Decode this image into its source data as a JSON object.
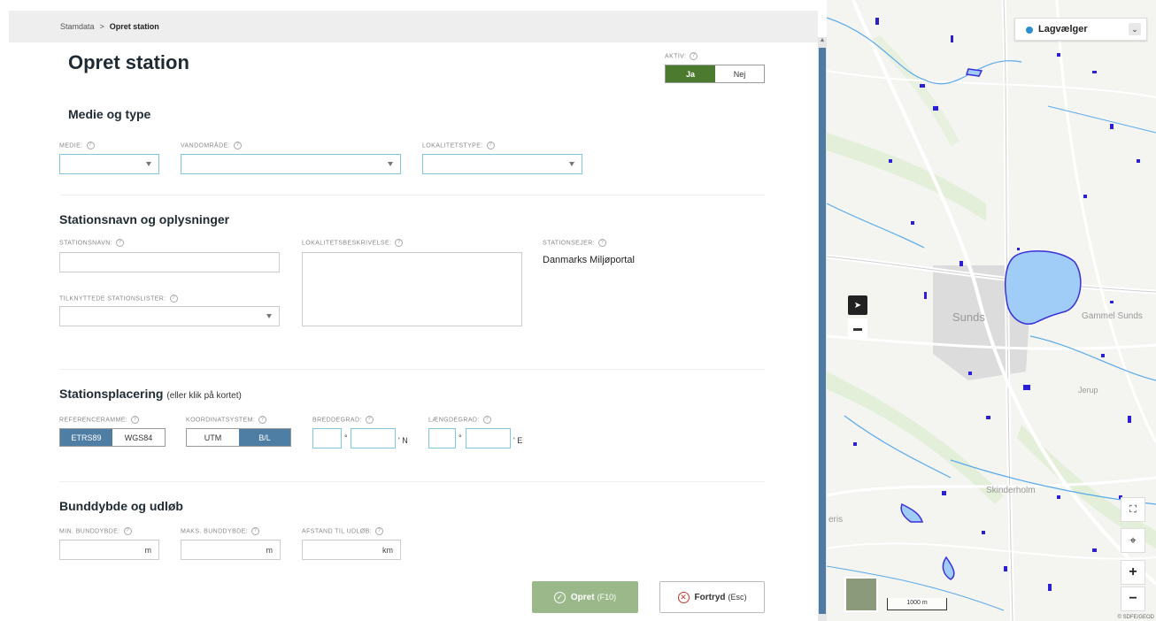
{
  "breadcrumb": {
    "root": "Stamdata",
    "separator": ">",
    "current": "Opret station"
  },
  "page_title": "Opret station",
  "aktiv": {
    "label": "AKTIV:",
    "yes": "Ja",
    "no": "Nej",
    "selected": "Ja"
  },
  "help_glyph": "?",
  "section_medie": {
    "title": "Medie og type",
    "medie_label": "MEDIE:",
    "vandomraade_label": "VANDOMRÅDE:",
    "lokalitetstype_label": "LOKALITETSTYPE:"
  },
  "section_station": {
    "title": "Stationsnavn og oplysninger",
    "stationsnavn_label": "STATIONSNAVN:",
    "lokalitetsbeskrivelse_label": "LOKALITETSBESKRIVELSE:",
    "stationsejer_label": "STATIONSEJER:",
    "stationsejer_value": "Danmarks Miljøportal",
    "tilknyttede_label": "TILKNYTTEDE STATIONSLISTER:"
  },
  "section_placering": {
    "title": "Stationsplacering",
    "subtitle": "(eller klik på kortet)",
    "referenceramme_label": "REFERENCERAMME:",
    "referenceramme_options": [
      "ETRS89",
      "WGS84"
    ],
    "referenceramme_selected": "ETRS89",
    "koordinatsystem_label": "KOORDINATSYSTEM:",
    "koordinatsystem_options": [
      "UTM",
      "B/L"
    ],
    "koordinatsystem_selected": "B/L",
    "breddegrad_label": "BREDDEGRAD:",
    "laengdegrad_label": "LÆNGDEGRAD:",
    "degree_symbol": "°",
    "north_suffix": "' N",
    "east_suffix": "' E"
  },
  "section_bund": {
    "title": "Bunddybde og udløb",
    "min_label": "MIN. BUNDDYBDE:",
    "maks_label": "MAKS. BUNDDYBDE:",
    "afstand_label": "AFSTAND TIL UDLØB:",
    "unit_m": "m",
    "unit_km": "km"
  },
  "actions": {
    "opret_label": "Opret",
    "opret_shortcut": "(F10)",
    "fortryd_label": "Fortryd",
    "fortryd_shortcut": "(Esc)"
  },
  "map": {
    "layer_picker_label": "Lagvælger",
    "place_labels": [
      "Sunds",
      "Gammel Sunds",
      "Skinderholm",
      "Jerup",
      "eris"
    ],
    "scale_label": "1000 m",
    "copyright": "© SDFE/GEOD",
    "zoom_in": "+",
    "zoom_out": "−"
  },
  "colors": {
    "accent_green": "#4c7a2f",
    "accent_blue": "#4f7ea5",
    "field_border": "#7fc6de",
    "button_opret": "#9ab88a"
  }
}
